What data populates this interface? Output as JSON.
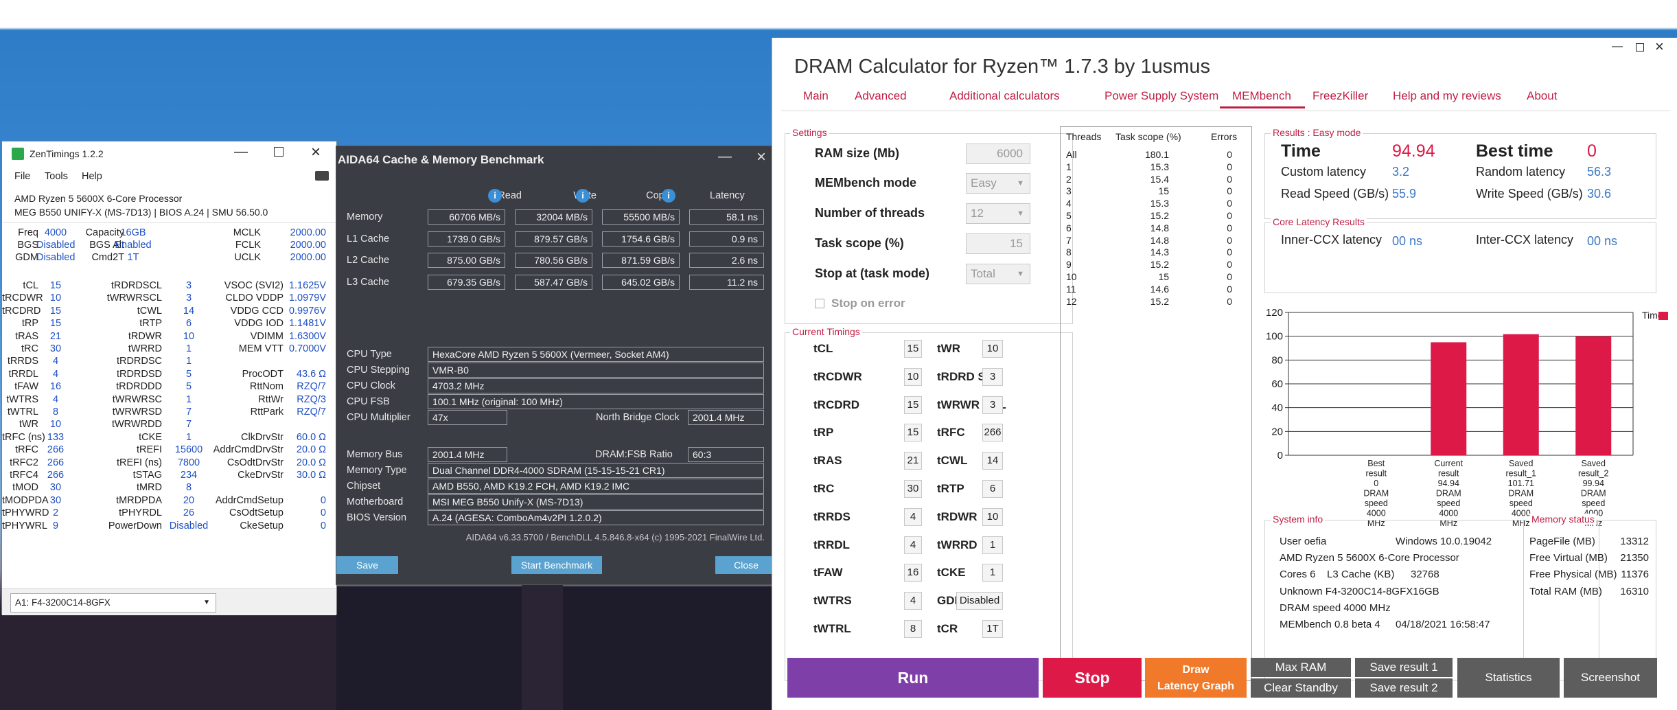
{
  "zentimings": {
    "title": "ZenTimings 1.2.2",
    "menu": [
      "File",
      "Tools",
      "Help"
    ],
    "cpu": "AMD Ryzen 5 5600X 6-Core Processor",
    "board": "MEG B550 UNIFY-X (MS-7D13) | BIOS A.24 | SMU 56.50.0",
    "top_rows": [
      {
        "l1": "Freq",
        "v1": "4000",
        "l2": "Capacity",
        "v2": "16GB",
        "l3": "MCLK",
        "v3": "2000.00"
      },
      {
        "l1": "BGS",
        "v1": "Disabled",
        "l2": "BGS Alt",
        "v2": "Enabled",
        "l3": "FCLK",
        "v3": "2000.00"
      },
      {
        "l1": "GDM",
        "v1": "Disabled",
        "l2": "Cmd2T",
        "v2": "1T",
        "l3": "UCLK",
        "v3": "2000.00"
      }
    ],
    "rows": [
      {
        "l1": "tCL",
        "v1": "15",
        "l2": "tRDRDSCL",
        "v2": "3",
        "l3": "VSOC (SVI2)",
        "v3": "1.1625V"
      },
      {
        "l1": "tRCDWR",
        "v1": "10",
        "l2": "tWRWRSCL",
        "v2": "3",
        "l3": "CLDO VDDP",
        "v3": "1.0979V"
      },
      {
        "l1": "tRCDRD",
        "v1": "15",
        "l2": "tCWL",
        "v2": "14",
        "l3": "VDDG CCD",
        "v3": "0.9976V"
      },
      {
        "l1": "tRP",
        "v1": "15",
        "l2": "tRTP",
        "v2": "6",
        "l3": "VDDG IOD",
        "v3": "1.1481V"
      },
      {
        "l1": "tRAS",
        "v1": "21",
        "l2": "tRDWR",
        "v2": "10",
        "l3": "VDIMM",
        "v3": "1.6300V"
      },
      {
        "l1": "tRC",
        "v1": "30",
        "l2": "tWRRD",
        "v2": "1",
        "l3": "MEM VTT",
        "v3": "0.7000V"
      },
      {
        "l1": "tRRDS",
        "v1": "4",
        "l2": "tRDRDSC",
        "v2": "1",
        "l3": "",
        "v3": ""
      },
      {
        "l1": "tRRDL",
        "v1": "4",
        "l2": "tRDRDSD",
        "v2": "5",
        "l3": "ProcODT",
        "v3": "43.6 Ω"
      },
      {
        "l1": "tFAW",
        "v1": "16",
        "l2": "tRDRDDD",
        "v2": "5",
        "l3": "RttNom",
        "v3": "RZQ/7"
      },
      {
        "l1": "tWTRS",
        "v1": "4",
        "l2": "tWRWRSC",
        "v2": "1",
        "l3": "RttWr",
        "v3": "RZQ/3"
      },
      {
        "l1": "tWTRL",
        "v1": "8",
        "l2": "tWRWRSD",
        "v2": "7",
        "l3": "RttPark",
        "v3": "RZQ/7"
      },
      {
        "l1": "tWR",
        "v1": "10",
        "l2": "tWRWRDD",
        "v2": "7",
        "l3": "",
        "v3": ""
      },
      {
        "l1": "tRFC (ns)",
        "v1": "133",
        "l2": "tCKE",
        "v2": "1",
        "l3": "ClkDrvStr",
        "v3": "60.0 Ω"
      },
      {
        "l1": "tRFC",
        "v1": "266",
        "l2": "tREFI",
        "v2": "15600",
        "l3": "AddrCmdDrvStr",
        "v3": "20.0 Ω"
      },
      {
        "l1": "tRFC2",
        "v1": "266",
        "l2": "tREFI (ns)",
        "v2": "7800",
        "l3": "CsOdtDrvStr",
        "v3": "20.0 Ω"
      },
      {
        "l1": "tRFC4",
        "v1": "266",
        "l2": "tSTAG",
        "v2": "234",
        "l3": "CkeDrvStr",
        "v3": "30.0 Ω"
      },
      {
        "l1": "tMOD",
        "v1": "30",
        "l2": "tMRD",
        "v2": "8",
        "l3": "",
        "v3": ""
      },
      {
        "l1": "tMODPDA",
        "v1": "30",
        "l2": "tMRDPDA",
        "v2": "20",
        "l3": "AddrCmdSetup",
        "v3": "0"
      },
      {
        "l1": "tPHYWRD",
        "v1": "2",
        "l2": "tPHYRDL",
        "v2": "26",
        "l3": "CsOdtSetup",
        "v3": "0"
      },
      {
        "l1": "tPHYWRL",
        "v1": "9",
        "l2": "PowerDown",
        "v2": "Disabled",
        "l3": "CkeSetup",
        "v3": "0"
      }
    ],
    "dimm_select": "A1: F4-3200C14-8GFX"
  },
  "aida": {
    "title": "AIDA64 Cache & Memory Benchmark",
    "headers": {
      "read": "Read",
      "write": "Write",
      "copy": "Copy",
      "latency": "Latency"
    },
    "bench_rows": [
      {
        "label": "Memory",
        "read": "60706 MB/s",
        "write": "32004 MB/s",
        "copy": "55500 MB/s",
        "latency": "58.1 ns"
      },
      {
        "label": "L1 Cache",
        "read": "1739.0 GB/s",
        "write": "879.57 GB/s",
        "copy": "1754.6 GB/s",
        "latency": "0.9 ns"
      },
      {
        "label": "L2 Cache",
        "read": "875.00 GB/s",
        "write": "780.56 GB/s",
        "copy": "871.59 GB/s",
        "latency": "2.6 ns"
      },
      {
        "label": "L3 Cache",
        "read": "679.35 GB/s",
        "write": "587.47 GB/s",
        "copy": "645.02 GB/s",
        "latency": "11.2 ns"
      }
    ],
    "cpu_type_label": "CPU Type",
    "cpu_type": "HexaCore AMD Ryzen 5 5600X  (Vermeer, Socket AM4)",
    "cpu_stepping_label": "CPU Stepping",
    "cpu_stepping": "VMR-B0",
    "cpu_clock_label": "CPU Clock",
    "cpu_clock": "4703.2 MHz",
    "cpu_fsb_label": "CPU FSB",
    "cpu_fsb": "100.1 MHz  (original: 100 MHz)",
    "cpu_mult_label": "CPU Multiplier",
    "cpu_mult": "47x",
    "nb_clock_label": "North Bridge Clock",
    "nb_clock": "2001.4 MHz",
    "mem_bus_label": "Memory Bus",
    "mem_bus": "2001.4 MHz",
    "ratio_label": "DRAM:FSB Ratio",
    "ratio": "60:3",
    "mem_type_label": "Memory Type",
    "mem_type": "Dual Channel DDR4-4000 SDRAM  (15-15-15-21 CR1)",
    "chipset_label": "Chipset",
    "chipset": "AMD B550, AMD K19.2 FCH, AMD K19.2 IMC",
    "mobo_label": "Motherboard",
    "mobo": "MSI MEG B550 Unify-X (MS-7D13)",
    "bios_label": "BIOS Version",
    "bios": "A.24  (AGESA: ComboAm4v2PI 1.2.0.2)",
    "footer": "AIDA64 v6.33.5700 / BenchDLL 4.5.846.8-x64  (c) 1995-2021 FinalWire Ltd.",
    "save": "Save",
    "start": "Start Benchmark",
    "close": "Close"
  },
  "dram": {
    "title": "DRAM Calculator for Ryzen™ 1.7.3 by 1usmus",
    "tabs": [
      "Main",
      "Advanced",
      "Additional calculators",
      "Power Supply System",
      "MEMbench",
      "FreezKiller",
      "Help and my reviews",
      "About"
    ],
    "settings_title": "Settings",
    "ram_size_label": "RAM size (Mb)",
    "ram_size": "6000",
    "mode_label": "MEMbench mode",
    "mode": "Easy",
    "threads_label": "Number of threads",
    "threads": "12",
    "scope_label": "Task scope (%)",
    "scope": "15",
    "stopat_label": "Stop at (task mode)",
    "stopat": "Total",
    "stop_on_error": "Stop on error",
    "timings_title": "Current Timings",
    "timings": [
      {
        "l1": "tCL",
        "v1": "15",
        "l2": "tWR",
        "v2": "10"
      },
      {
        "l1": "tRCDWR",
        "v1": "10",
        "l2": "tRDRD SCL",
        "v2": "3"
      },
      {
        "l1": "tRCDRD",
        "v1": "15",
        "l2": "tWRWR SCL",
        "v2": "3"
      },
      {
        "l1": "tRP",
        "v1": "15",
        "l2": "tRFC",
        "v2": "266"
      },
      {
        "l1": "tRAS",
        "v1": "21",
        "l2": "tCWL",
        "v2": "14"
      },
      {
        "l1": "tRC",
        "v1": "30",
        "l2": "tRTP",
        "v2": "6"
      },
      {
        "l1": "tRRDS",
        "v1": "4",
        "l2": "tRDWR",
        "v2": "10"
      },
      {
        "l1": "tRRDL",
        "v1": "4",
        "l2": "tWRRD",
        "v2": "1"
      },
      {
        "l1": "tFAW",
        "v1": "16",
        "l2": "tCKE",
        "v2": "1"
      },
      {
        "l1": "tWTRS",
        "v1": "4",
        "l2": "GDM",
        "v2": "Disabled"
      },
      {
        "l1": "tWTRL",
        "v1": "8",
        "l2": "tCR",
        "v2": "1T"
      }
    ],
    "thread_headers": [
      "Threads",
      "Task scope (%)",
      "Errors"
    ],
    "thread_rows": [
      [
        "All",
        "180.1",
        "0"
      ],
      [
        "1",
        "15.3",
        "0"
      ],
      [
        "2",
        "15.4",
        "0"
      ],
      [
        "3",
        "15",
        "0"
      ],
      [
        "4",
        "15.3",
        "0"
      ],
      [
        "5",
        "15.2",
        "0"
      ],
      [
        "6",
        "14.8",
        "0"
      ],
      [
        "7",
        "14.8",
        "0"
      ],
      [
        "8",
        "14.3",
        "0"
      ],
      [
        "9",
        "15.2",
        "0"
      ],
      [
        "10",
        "15",
        "0"
      ],
      [
        "11",
        "14.6",
        "0"
      ],
      [
        "12",
        "15.2",
        "0"
      ]
    ],
    "results_title": "Results : Easy mode",
    "time_label": "Time",
    "time": "94.94",
    "best_label": "Best time",
    "best": "0",
    "custom_lat_label": "Custom latency",
    "custom_lat": "3.2",
    "random_lat_label": "Random latency",
    "random_lat": "56.3",
    "read_label": "Read Speed (GB/s)",
    "read": "55.9",
    "write_label": "Write Speed (GB/s)",
    "write": "30.6",
    "core_lat_title": "Core Latency Results",
    "inner_label": "Inner-CCX latency",
    "inner": "00 ns",
    "inter_label": "Inter-CCX latency",
    "inter": "00 ns",
    "sysinfo_title": "System info",
    "user_label": "User oefia",
    "os": "Windows 10.0.19042",
    "cpu": "AMD Ryzen 5 5600X 6-Core Processor",
    "cores": "Cores 6",
    "l3_label": "L3 Cache (KB)",
    "l3": "32768",
    "mem_part": "Unknown F4-3200C14-8GFX16GB",
    "dram_speed": "DRAM speed 4000 MHz",
    "membench_ver": "MEMbench 0.8 beta 4",
    "date": "04/18/2021 16:58:47",
    "memstatus_title": "Memory status",
    "pagefile_label": "PageFile (MB)",
    "pagefile": "13312",
    "freevirt_label": "Free Virtual (MB)",
    "freevirt": "21350",
    "freephys_label": "Free Physical (MB)",
    "freephys": "11376",
    "totalram_label": "Total RAM (MB)",
    "totalram": "16310",
    "buttons": {
      "run": "Run",
      "stop": "Stop",
      "draw1": "Draw",
      "draw2": "Latency Graph",
      "maxram": "Max RAM",
      "clearstandby": "Clear Standby",
      "save1": "Save result 1",
      "save2": "Save result 2",
      "stats": "Statistics",
      "screenshot": "Screenshot"
    },
    "colors": {
      "accent": "#c01f45",
      "run": "#7e3fa8",
      "stop": "#dc1947",
      "draw": "#f07a2a",
      "gray": "#5d5d5d"
    }
  },
  "chart_data": {
    "type": "bar",
    "categories": [
      "Best result 0 DRAM speed 4000 MHz",
      "Current result 94.94 DRAM speed 4000 MHz",
      "Saved result_1 101.71 DRAM speed 4000 MHz",
      "Saved result_2 99.94 DRAM speed 4000 MHz"
    ],
    "category_lines": [
      [
        "Best",
        "result",
        "0",
        "DRAM",
        "speed",
        "4000",
        "MHz"
      ],
      [
        "Current",
        "result",
        "94.94",
        "DRAM",
        "speed",
        "4000",
        "MHz"
      ],
      [
        "Saved",
        "result_1",
        "101.71",
        "DRAM",
        "speed",
        "4000",
        "MHz"
      ],
      [
        "Saved",
        "result_2",
        "99.94",
        "DRAM",
        "speed",
        "4000",
        "MHz"
      ]
    ],
    "series": [
      {
        "name": "Time",
        "values": [
          0,
          94.94,
          101.71,
          99.94
        ],
        "color": "#dc1947"
      }
    ],
    "ylim": [
      0,
      120
    ],
    "yticks": [
      "0",
      "20",
      "40",
      "60",
      "80",
      "100",
      "120"
    ],
    "grid": true,
    "legend": "top-right"
  }
}
